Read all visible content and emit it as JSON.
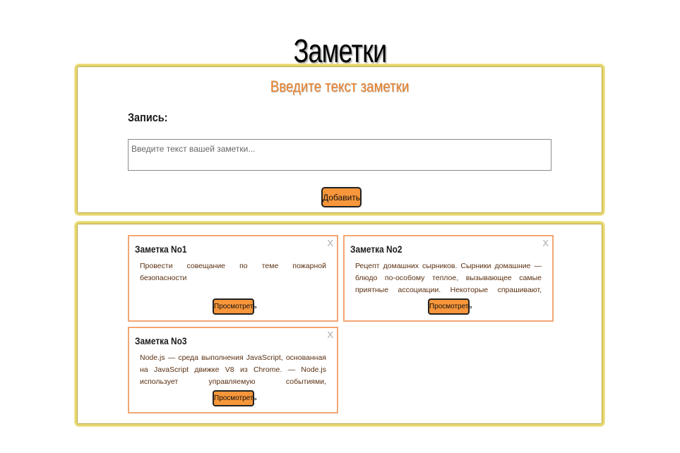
{
  "page": {
    "title": "Заметки"
  },
  "form": {
    "heading": "Введите текст заметки",
    "label": "Запись:",
    "placeholder": "Введите текст вашей заметки...",
    "value": "",
    "add_label": "Добавить"
  },
  "notes": [
    {
      "title": "Заметка No1",
      "text": "Провести совещание по теме пожарной безопасности",
      "close": "X",
      "view_label": "Просмотреть"
    },
    {
      "title": "Заметка No2",
      "text": "Рецепт домашних сырников. Сырники домашние — блюдо по-особому теплое, вызывающее самые приятные ассоциации. Некоторые спрашивают, почему их называют именно так, ве...",
      "close": "X",
      "view_label": "Просмотреть"
    },
    {
      "title": "Заметка No3",
      "text": "Node.js — среда выполнения JavaScript, основанная на JavaScript движке V8 из Chrome. — Node.js использует управляемую событиями, неблокирующую модель ввод...",
      "close": "X",
      "view_label": "Просмотреть"
    }
  ],
  "colors": {
    "accent": "#f7963a",
    "heading": "#e8812a",
    "panel_border": "#e6d66e",
    "card_border": "#f3a673"
  }
}
